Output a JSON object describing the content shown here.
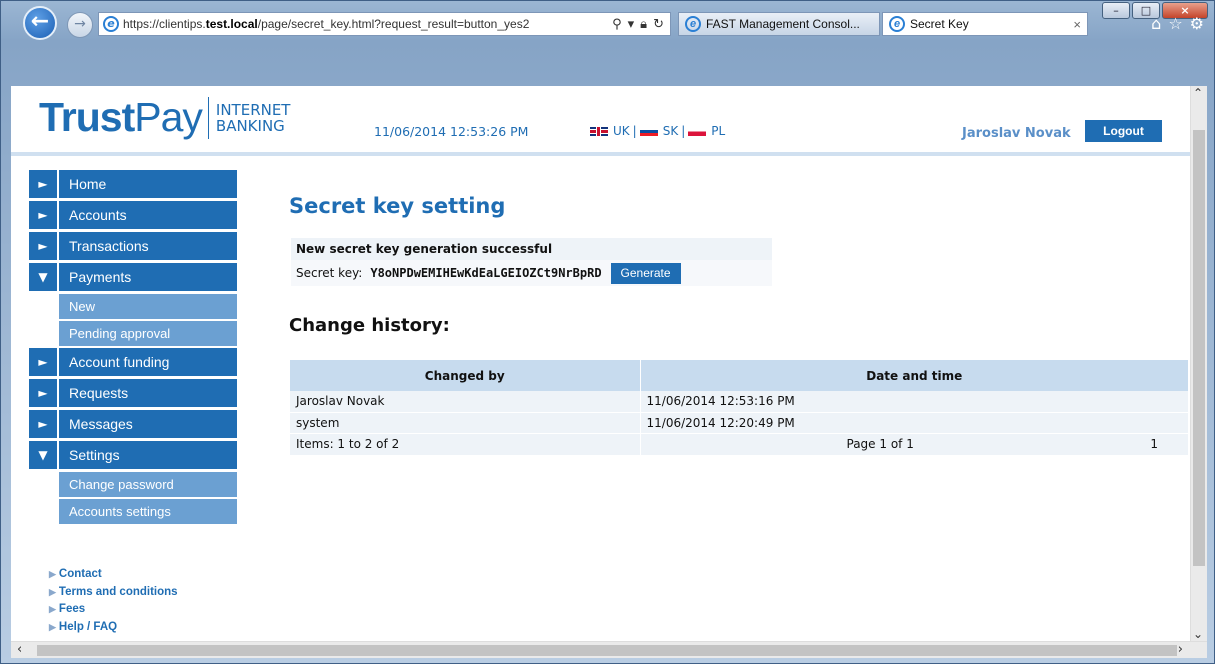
{
  "browser": {
    "url_prefix": "https://clientips.",
    "url_host": "test.local",
    "url_suffix": "/page/secret_key.html?request_result=button_yes2",
    "tabs": [
      {
        "label": "FAST Management Consol..."
      },
      {
        "label": "Secret Key",
        "close": "×"
      }
    ]
  },
  "header": {
    "logo_trust": "Trust",
    "logo_pay": "Pay",
    "logo_line1": "INTERNET",
    "logo_line2": "BANKING",
    "datetime": "11/06/2014 12:53:26 PM",
    "languages": [
      "UK",
      "SK",
      "PL"
    ],
    "lang_separator": "|",
    "user_name": "Jaroslav Novak",
    "logout_label": "Logout"
  },
  "sidebar": {
    "items": [
      {
        "label": "Home",
        "arrow": "►"
      },
      {
        "label": "Accounts",
        "arrow": "►"
      },
      {
        "label": "Transactions",
        "arrow": "►"
      },
      {
        "label": "Payments",
        "arrow": "▼"
      },
      {
        "label": "Account funding",
        "arrow": "►"
      },
      {
        "label": "Requests",
        "arrow": "►"
      },
      {
        "label": "Messages",
        "arrow": "►"
      },
      {
        "label": "Settings",
        "arrow": "▼"
      }
    ],
    "payments_sub": [
      "New",
      "Pending approval"
    ],
    "settings_sub": [
      "Change password",
      "Accounts settings"
    ],
    "footer_links": [
      "Contact",
      "Terms and conditions",
      "Fees",
      "Help / FAQ"
    ]
  },
  "main": {
    "title": "Secret key setting",
    "success_message": "New secret key generation successful",
    "secret_key_label": "Secret key:",
    "secret_key_value": "Y8oNPDwEMIHEwKdEaLGEIOZCt9NrBpRD",
    "generate_label": "Generate",
    "history_title": "Change history:",
    "table": {
      "headers": [
        "Changed by",
        "Date and time"
      ],
      "rows": [
        [
          "Jaroslav Novak",
          "11/06/2014 12:53:16 PM"
        ],
        [
          "system",
          "11/06/2014 12:20:49 PM"
        ]
      ],
      "items_text": "Items: 1 to 2 of 2",
      "page_text": "Page 1 of 1",
      "page_number": "1"
    }
  }
}
